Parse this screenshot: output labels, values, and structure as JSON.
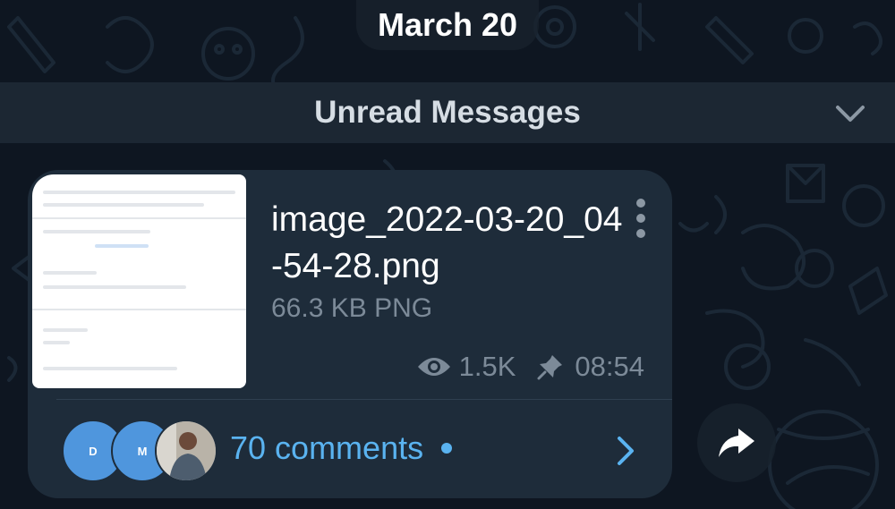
{
  "date_divider": "March 20",
  "unread_banner": {
    "label": "Unread Messages"
  },
  "message": {
    "file_name": "image_2022-03-20_04-54-28.png",
    "file_meta": "66.3 KB PNG",
    "views": "1.5K",
    "time": "08:54"
  },
  "comments": {
    "label": "70 comments",
    "avatars": [
      {
        "initial": "D",
        "color": "#4f96dd"
      },
      {
        "initial": "M",
        "color": "#4f96dd"
      },
      {
        "initial": "",
        "color": "#8e9aa5"
      }
    ]
  },
  "colors": {
    "background": "#0e1621",
    "bubble": "#1e2c3a",
    "accent": "#5ab3f0",
    "muted_text": "#7c8a98"
  },
  "icons": {
    "views": "eye-icon",
    "pinned": "pin-icon",
    "more": "more-vertical-icon",
    "collapse": "chevron-down-icon",
    "open_comments": "chevron-right-icon",
    "share": "share-arrow-icon"
  }
}
